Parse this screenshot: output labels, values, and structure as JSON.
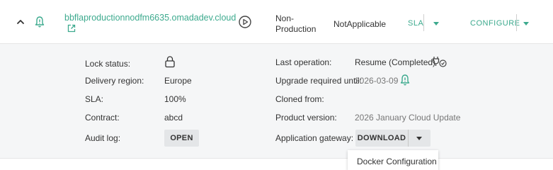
{
  "row": {
    "hostname": "bbflaproductionnodfm6635.omadadev.cloud",
    "environment_line1": "Non-",
    "environment_line2": "Production",
    "sla_status": "NotApplicable",
    "sla_button": "SLA",
    "configure_button": "CONFIGURE",
    "icons": [
      "chevron-up-icon",
      "bell-icon",
      "external-link-icon",
      "play-circle-icon",
      "chevron-down-icon"
    ]
  },
  "details": {
    "lock_status_label": "Lock status:",
    "lock_icon": "lock-icon",
    "delivery_region_label": "Delivery region:",
    "delivery_region": "Europe",
    "sla_label": "SLA:",
    "sla_value": "100%",
    "contract_label": "Contract:",
    "contract_value": "abcd",
    "audit_log_label": "Audit log:",
    "audit_log_button": "OPEN",
    "last_operation_label": "Last operation:",
    "last_operation_value": "Resume (Completed)",
    "last_operation_icon": "plug-check-icon",
    "upgrade_label": "Upgrade required until:",
    "upgrade_value": "2026-03-09",
    "upgrade_icon": "bell-icon",
    "cloned_from_label": "Cloned from:",
    "product_version_label": "Product version:",
    "product_version_value": "2026 January Cloud Update",
    "app_gateway_label": "Application gateway:",
    "download_button": "DOWNLOAD"
  },
  "dropdown": {
    "items": [
      "Docker Configuration"
    ]
  },
  "colors": {
    "accent": "#3daa8e",
    "detail_bg": "#f5f6f7",
    "button_bg": "#e4e6e8"
  }
}
